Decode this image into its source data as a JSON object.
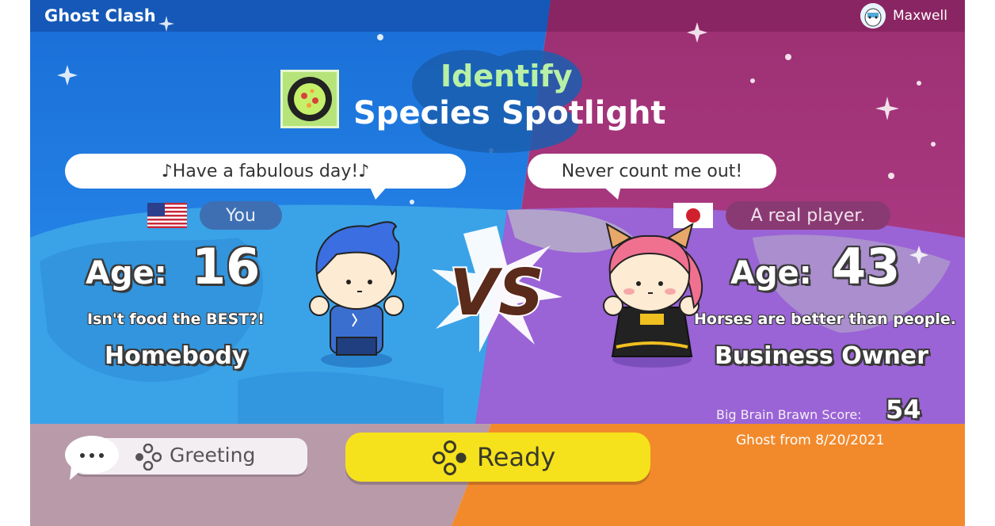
{
  "app": {
    "title": "Ghost Clash"
  },
  "user": {
    "name": "Maxwell",
    "avatar_icon": "player-avatar-icon"
  },
  "mode": {
    "category": "Identify",
    "name": "Species Spotlight",
    "icon": "species-thumbnail-icon"
  },
  "vs_label": "VS",
  "player_left": {
    "message": "♪Have a fabulous day!♪",
    "flag_icon": "us-flag-icon",
    "name": "You",
    "age_label": "Age:",
    "age": "16",
    "tagline": "Isn't food the BEST?!",
    "title": "Homebody"
  },
  "player_right": {
    "message": "Never count me out!",
    "flag_icon": "japan-flag-icon",
    "name": "A real player.",
    "age_label": "Age:",
    "age": "43",
    "tagline": "Horses are better than people.",
    "title": "Business Owner",
    "score_label": "Big Brain Brawn Score:",
    "score": "54",
    "ghost_note": "Ghost from 8/20/2021"
  },
  "buttons": {
    "greeting_label": "Greeting",
    "ready_label": "Ready",
    "chat_icon": "chat-bubble-icon",
    "controller_icon": "button-cluster-icon"
  },
  "colors": {
    "left_bg": "#1f7fe0",
    "right_bg": "#a8397a",
    "ready_bg": "#f6e21c",
    "bottom_left": "#b89aa8",
    "bottom_right": "#f28a2c"
  }
}
